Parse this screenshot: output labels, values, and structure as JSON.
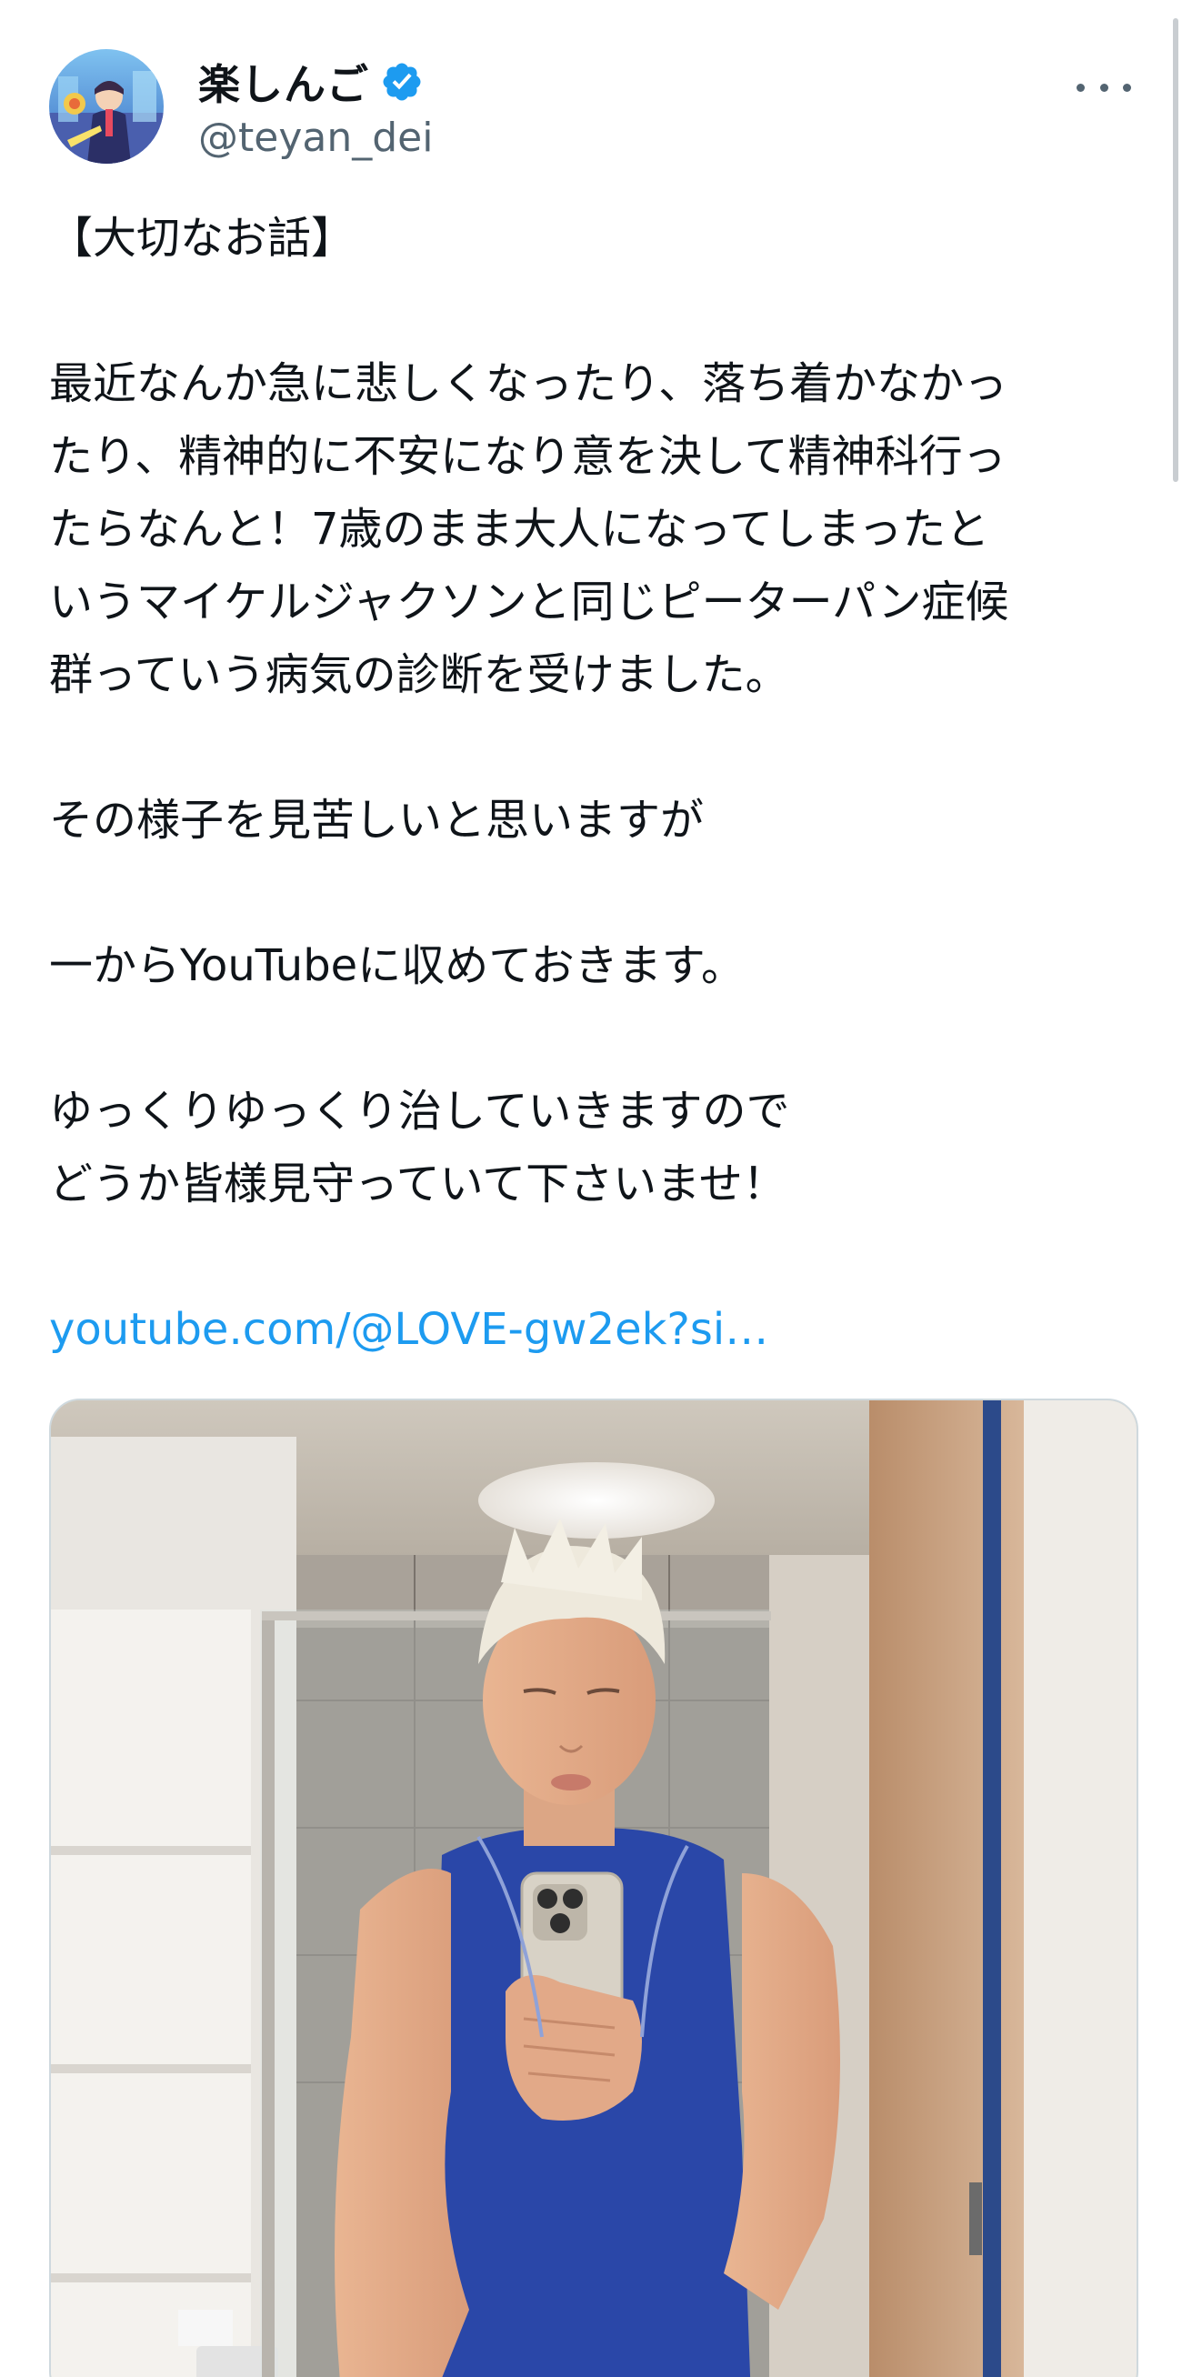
{
  "author": {
    "display_name": "楽しんご",
    "handle": "@teyan_dei",
    "verified": true,
    "avatar_icon": "avatar-image",
    "verified_icon": "verified-badge-icon",
    "more_icon": "more-options-icon"
  },
  "tweet": {
    "lines": [
      "【大切なお話】",
      "",
      "最近なんか急に悲しくなったり、落ち着かなかっ",
      "たり、精神的に不安になり意を決して精神科行っ",
      "たらなんと！7歳のまま大人になってしまったと",
      "いうマイケルジャクソンと同じピーターパン症候",
      "群っていう病気の診断を受けました。",
      "",
      "その様子を見苦しいと思いますが",
      "",
      "一からYouTubeに収めておきます。",
      "",
      "ゆっくりゆっくり治していきますので",
      "どうか皆様見守っていて下さいませ！",
      ""
    ],
    "link_text": "youtube.com/@LOVE-gw2ek?si…"
  },
  "media": {
    "type": "photo",
    "description_icon": "mirror-selfie-photo"
  },
  "colors": {
    "text": "#0f1419",
    "secondary": "#536471",
    "link": "#1d9bf0",
    "verified": "#1d9bf0",
    "border": "#cfd9de"
  }
}
